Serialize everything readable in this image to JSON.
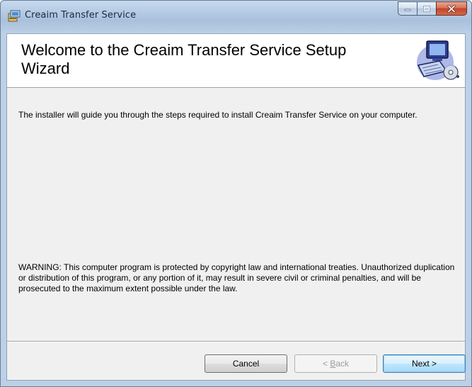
{
  "window": {
    "title": "Creaim Transfer Service",
    "icons": {
      "app": "installer-package-icon",
      "minimize": "minimize-icon",
      "maximize": "maximize-icon",
      "close": "close-icon",
      "banner": "computer-setup-icon"
    }
  },
  "banner": {
    "title": "Welcome to the Creaim Transfer Service Setup Wizard"
  },
  "body": {
    "intro": "The installer will guide you through the steps required to install Creaim Transfer Service on your computer.",
    "warning": "WARNING: This computer program is protected by copyright law and international treaties. Unauthorized duplication or distribution of this program, or any portion of it, may result in severe civil or criminal penalties, and will be prosecuted to the maximum extent possible under the law."
  },
  "buttons": {
    "cancel": "Cancel",
    "back_prefix": "< ",
    "back_accel": "B",
    "back_rest": "ack",
    "next": "Next >"
  },
  "colors": {
    "close_button": "#c2442a",
    "default_button_border": "#3c7fb1"
  }
}
